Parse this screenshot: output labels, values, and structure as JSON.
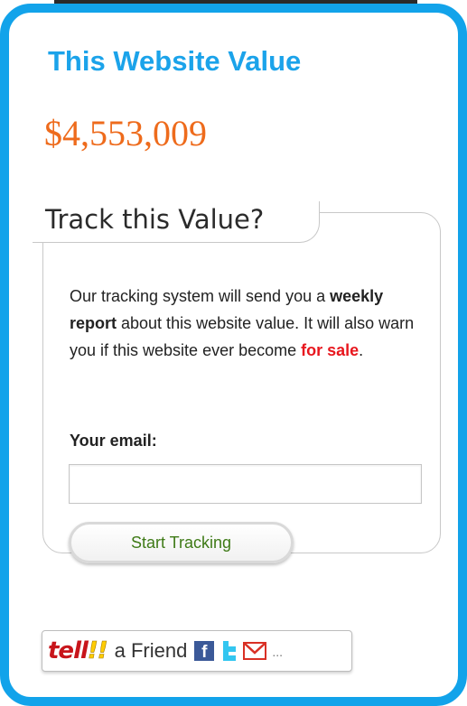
{
  "widget": {
    "title": "This Website Value",
    "value": "$4,553,009",
    "accent_color": "#12a3ea",
    "value_color": "#ee6b1c"
  },
  "track": {
    "heading": "Track this Value?",
    "description": {
      "part1": "Our tracking system will send you a ",
      "bold": "weekly report",
      "part2": " about this website value. It will also warn you if this website ever become ",
      "highlight": "for sale",
      "part3": "."
    },
    "email_label": "Your email:",
    "email_value": "",
    "email_placeholder": "",
    "button_label": "Start Tracking",
    "highlight_color": "#e8171e"
  },
  "tell_friend": {
    "logo_text": "tell",
    "logo_excl": "!!",
    "label": "a Friend",
    "more": "...",
    "icons": [
      "facebook-icon",
      "twitter-icon",
      "gmail-icon"
    ]
  }
}
